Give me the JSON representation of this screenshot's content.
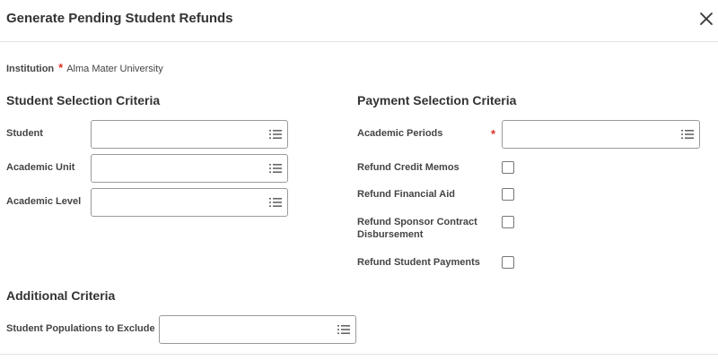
{
  "dialog": {
    "title": "Generate Pending Student Refunds",
    "close_icon": "close-icon"
  },
  "institution": {
    "label": "Institution",
    "required_mark": "*",
    "value": "Alma Mater University"
  },
  "student_selection": {
    "title": "Student Selection Criteria",
    "fields": [
      {
        "label": "Student",
        "value": "",
        "icon": "list-prompt-icon"
      },
      {
        "label": "Academic Unit",
        "value": "",
        "icon": "list-prompt-icon"
      },
      {
        "label": "Academic Level",
        "value": "",
        "icon": "list-prompt-icon"
      }
    ]
  },
  "payment_selection": {
    "title": "Payment Selection Criteria",
    "academic_periods": {
      "label": "Academic Periods",
      "required_mark": "*",
      "value": "",
      "icon": "list-prompt-icon"
    },
    "checkboxes": [
      {
        "label": "Refund Credit Memos",
        "checked": false
      },
      {
        "label": "Refund Financial Aid",
        "checked": false
      },
      {
        "label_line1": "Refund Sponsor Contract",
        "label_line2": "Disbursement",
        "checked": false
      },
      {
        "label": "Refund Student Payments",
        "checked": false
      }
    ]
  },
  "additional": {
    "title": "Additional Criteria",
    "populations": {
      "label": "Student Populations to Exclude",
      "value": "",
      "icon": "list-prompt-icon"
    }
  }
}
